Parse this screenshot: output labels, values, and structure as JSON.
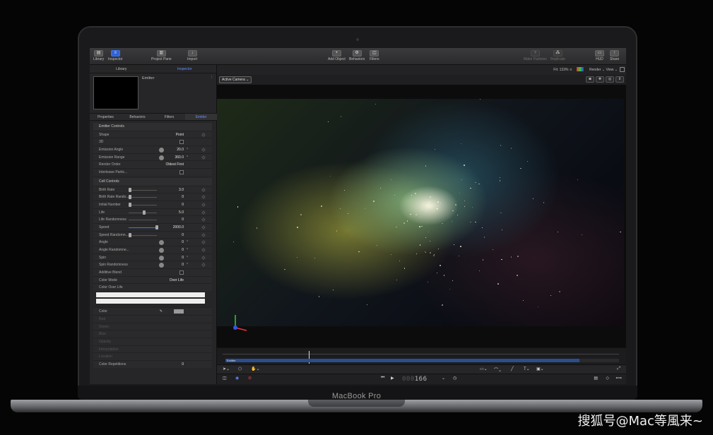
{
  "toolbar": {
    "library": "Library",
    "inspector": "Inspector",
    "project_pane": "Project Pane",
    "import": "Import",
    "add_object": "Add Object",
    "behaviors": "Behaviors",
    "filters": "Filters",
    "make_particles": "Make Particles",
    "replicate": "Replicate",
    "hud": "HUD",
    "share": "Share"
  },
  "left_panel": {
    "tab_library": "Library",
    "tab_inspector": "Inspector",
    "preview_title": "Emitter",
    "sub_tabs": [
      "Properties",
      "Behaviors",
      "Filters",
      "Emitter"
    ],
    "emitter_controls": {
      "header": "Emitter Controls",
      "rows": [
        {
          "label": "Shape",
          "value": "Point"
        },
        {
          "label": "3D",
          "value": ""
        },
        {
          "label": "Emission Angle",
          "value": "20.0",
          "unit": "°"
        },
        {
          "label": "Emission Range",
          "value": "360.0",
          "unit": "°"
        },
        {
          "label": "Render Order",
          "value": "Oldest First"
        },
        {
          "label": "Interleave Partic...",
          "value": ""
        }
      ]
    },
    "cell_controls": {
      "header": "Cell Controls",
      "rows": [
        {
          "label": "Birth Rate",
          "value": "3.0"
        },
        {
          "label": "Birth Rate Rando...",
          "value": "0"
        },
        {
          "label": "Initial Number",
          "value": "0"
        },
        {
          "label": "Life",
          "value": "5.0"
        },
        {
          "label": "Life Randomness",
          "value": "0"
        },
        {
          "label": "Speed",
          "value": "2000.0"
        },
        {
          "label": "Speed Randomn...",
          "value": "0"
        },
        {
          "label": "Angle",
          "value": "0",
          "unit": "°"
        },
        {
          "label": "Angle Randomne...",
          "value": "0",
          "unit": "°"
        },
        {
          "label": "Spin",
          "value": "0",
          "unit": "°"
        },
        {
          "label": "Spin Randomness",
          "value": "0",
          "unit": "°"
        },
        {
          "label": "Additive Blend",
          "value": ""
        },
        {
          "label": "Color Mode",
          "value": "Over Life"
        },
        {
          "label": "Color Over Life",
          "value": ""
        }
      ]
    },
    "color_rows": [
      {
        "label": "Color"
      },
      {
        "label": "Red"
      },
      {
        "label": "Green"
      },
      {
        "label": "Blue"
      },
      {
        "label": "Opacity"
      },
      {
        "label": "Interpolation"
      },
      {
        "label": "Location"
      },
      {
        "label": "Color Repetitions",
        "value": "0"
      }
    ]
  },
  "viewer": {
    "fit": "Fit: 133% ≎",
    "render": "Render ⌄",
    "view": "View ⌄",
    "camera": "Active Camera ⌄",
    "track_name": "Emitter",
    "timecode": "166",
    "timecode_dim": "000"
  },
  "device": {
    "brand": "MacBook Pro",
    "watermark": "搜狐号@Mac等風来~"
  },
  "colors": {
    "accent": "#2f63d8",
    "tab_active": "#6a8cff",
    "track": "#2a4e8c"
  }
}
